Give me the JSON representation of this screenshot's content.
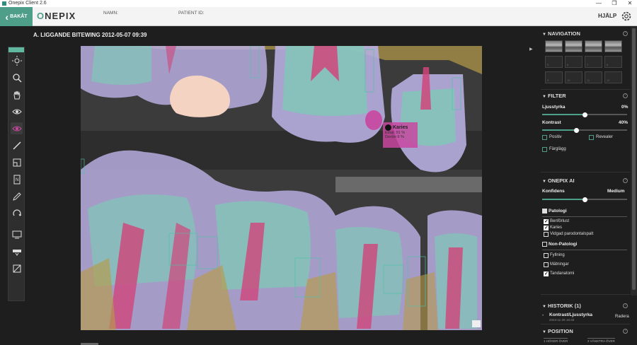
{
  "window": {
    "title": "Onepix Client 2.6",
    "minimize": "—",
    "maximize": "❐",
    "close": "✕"
  },
  "header": {
    "back_label": "BAKÅT",
    "logo_prefix": "O",
    "logo_rest": "NEPIX",
    "name_label": "NAMN:",
    "patient_label": "PATIENT ID:",
    "help_label": "HJÄLP"
  },
  "image": {
    "title": "A. LIGGANDE BITEWING 2012-05-07 09:39"
  },
  "toolbar": {
    "tools": [
      "brightness-icon",
      "zoom-icon",
      "pan-hand-icon",
      "view-eye-icon",
      "ai-overlay-icon",
      "ruler-icon",
      "crop-icon",
      "note-icon",
      "pen-icon",
      "rotate-icon",
      "monitor-icon",
      "export-icon",
      "compare-icon"
    ]
  },
  "popup": {
    "label": "Karies",
    "line1": "Emal: 91 %",
    "line2": "Dentin 9 %"
  },
  "sidebar": {
    "navigation": {
      "title": "NAVIGATION",
      "slots": [
        "1",
        "2",
        "3",
        "4",
        "5",
        "6",
        "7",
        "8",
        "9",
        "10",
        "11",
        "12"
      ]
    },
    "filter": {
      "title": "FILTER",
      "brightness_label": "Ljusstyrka",
      "brightness_value": "0%",
      "brightness_level": 0.5,
      "contrast_label": "Kontrast",
      "contrast_value": "40%",
      "contrast_level": 0.4,
      "positive_label": "Positiv",
      "reveal_label": "Revealer",
      "color_label": "Färglägg"
    },
    "ai": {
      "title": "ONEPIX AI",
      "confidence_label": "Konfidens",
      "confidence_value": "Medium",
      "confidence_level": 0.5,
      "pathology_label": "Patologi",
      "pathology_items": [
        "Benförlust",
        "Karies",
        "Vidgad parodontalspalt"
      ],
      "nonpathology_label": "Non-Patologi",
      "nonpathology_items": [
        "Fyllning",
        "Mätningar",
        "Tandanatomi"
      ]
    },
    "history": {
      "title": "HISTORIK (1)",
      "item_title": "Kontrast/Ljusstyrka",
      "item_time": "2023-11-28 16:48",
      "delete_label": "Radera"
    },
    "position": {
      "title": "POSITION",
      "tab1": "1 HÖGER ÖVER",
      "tab2": "2 VÄNSTRA ÖVER"
    }
  },
  "colors": {
    "accent": "#4e9e8a",
    "caries": "#c846a0",
    "enamel": "#b7aee0",
    "dentin": "#7fc8b6",
    "pulp": "#d0457a",
    "bone": "#b79b4a",
    "filling": "#f4d3c2"
  }
}
